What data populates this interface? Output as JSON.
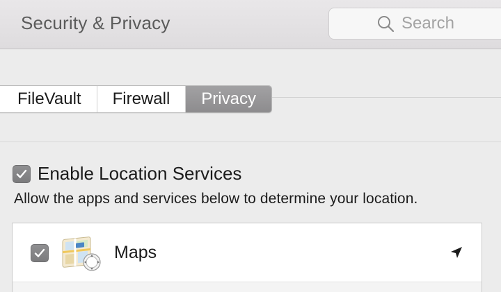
{
  "window": {
    "title": "Security & Privacy"
  },
  "search": {
    "placeholder": "Search",
    "icon": "search-icon"
  },
  "tabs": [
    {
      "label": "FileVault",
      "selected": false
    },
    {
      "label": "Firewall",
      "selected": false
    },
    {
      "label": "Privacy",
      "selected": true
    }
  ],
  "location_services": {
    "enable_label": "Enable Location Services",
    "enabled": true,
    "description": "Allow the apps and services below to determine your location."
  },
  "apps": [
    {
      "name": "Maps",
      "checked": true,
      "icon": "maps-app-icon",
      "status_icon": "location-arrow-icon"
    }
  ],
  "colors": {
    "selected_tab": "#8d8c8e",
    "checkbox": "#7b7b7d"
  }
}
